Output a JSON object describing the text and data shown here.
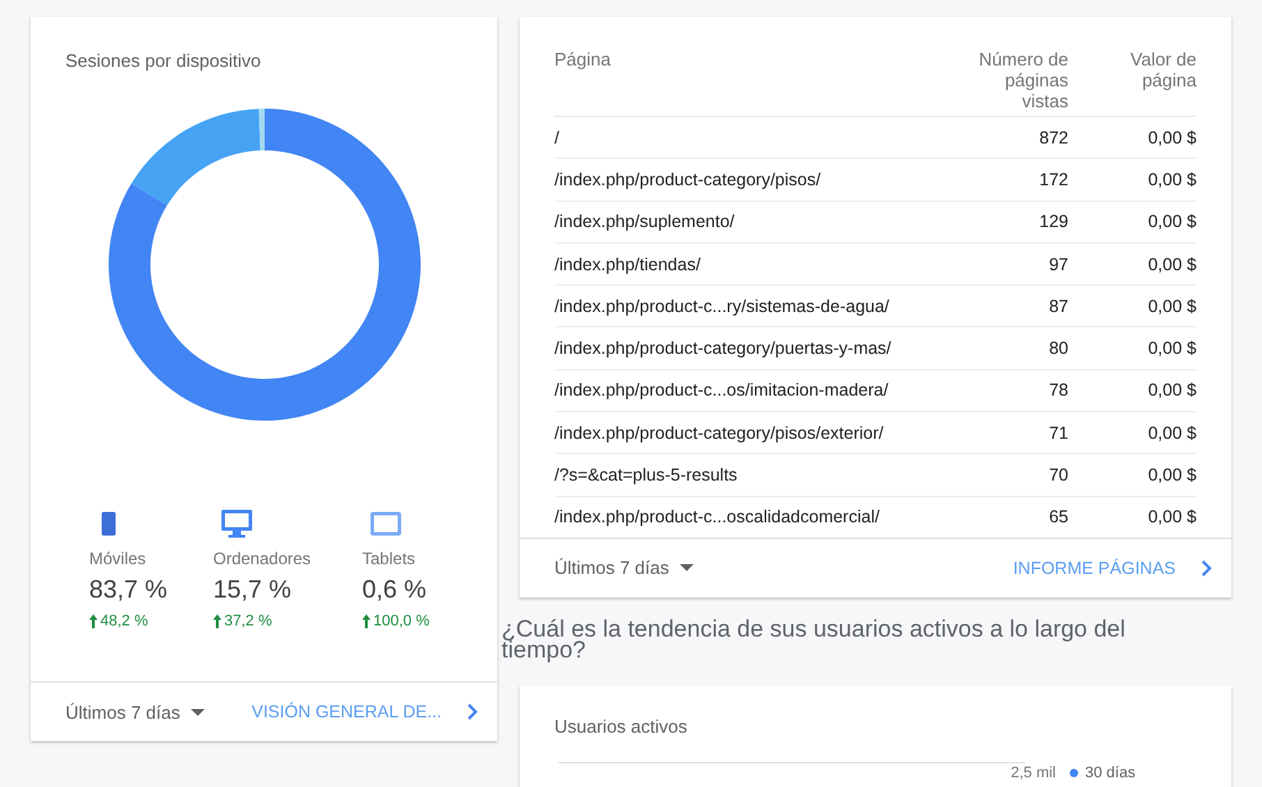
{
  "devices_card": {
    "title": "Sesiones por dispositivo",
    "chart_data": {
      "type": "donut",
      "categories": [
        "Móviles",
        "Ordenadores",
        "Tablets"
      ],
      "series": [
        {
          "values": [
            83.7,
            15.7,
            0.6
          ]
        }
      ],
      "colors": [
        "#4285f4",
        "#46a3f4",
        "#a3d9f0"
      ]
    },
    "devices": [
      {
        "kind": "mobile",
        "value": "83,7 %",
        "change": "48,2 %"
      },
      {
        "kind": "desktop",
        "value": "15,7 %",
        "change": "37,2 %"
      },
      {
        "kind": "tablet",
        "value": "0,6 %",
        "change": "100,0 %"
      }
    ],
    "period": "Últimos 7 días",
    "link": "VISIÓN GENERAL DE..."
  },
  "pages_card": {
    "columns": [
      "Página",
      "Número de páginas vistas",
      "Valor de página"
    ],
    "rows": [
      [
        "/",
        "872",
        "0,00 $"
      ],
      [
        "/index.php/product-category/pisos/",
        "172",
        "0,00 $"
      ],
      [
        "/index.php/suplemento/",
        "129",
        "0,00 $"
      ],
      [
        "/index.php/tiendas/",
        "97",
        "0,00 $"
      ],
      [
        "/index.php/product-c...ry/sistemas-de-agua/",
        "87",
        "0,00 $"
      ],
      [
        "/index.php/product-category/puertas-y-mas/",
        "80",
        "0,00 $"
      ],
      [
        "/index.php/product-c...os/imitacion-madera/",
        "78",
        "0,00 $"
      ],
      [
        "/index.php/product-category/pisos/exterior/",
        "71",
        "0,00 $"
      ],
      [
        "/?s=&cat=plus-5-results",
        "70",
        "0,00 $"
      ],
      [
        "/index.php/product-c...oscalidadcomercial/",
        "65",
        "0,00 $"
      ]
    ],
    "period": "Últimos 7 días",
    "link": "INFORME PÁGINAS"
  },
  "question": "¿Cuál es la tendencia de sus usuarios activos a lo largo del tiempo?",
  "users_card": {
    "title": "Usuarios activos",
    "gridline_label": "2,5 mil",
    "legend": "30 días"
  }
}
